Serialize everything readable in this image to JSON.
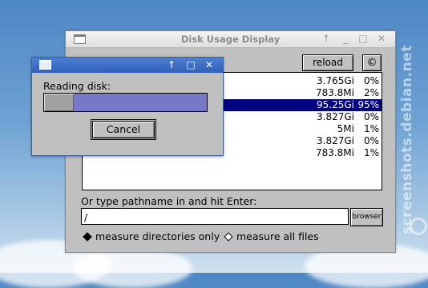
{
  "watermark": {
    "text": "screenshots.debian.net"
  },
  "main_window": {
    "title": "Disk Usage Display",
    "reload_label": "reload",
    "copyright_label": "©",
    "entries": [
      {
        "size": "3.765Gi",
        "pct": "0%",
        "selected": false
      },
      {
        "size": "783.8Mi",
        "pct": "2%",
        "selected": false
      },
      {
        "size": "95.25Gi",
        "pct": "95%",
        "selected": true
      },
      {
        "size": "3.827Gi",
        "pct": "0%",
        "selected": false
      },
      {
        "size": "5Mi",
        "pct": "1%",
        "selected": false
      },
      {
        "size": "3.827Gi",
        "pct": "0%",
        "selected": false
      },
      {
        "size": "783.8Mi",
        "pct": "1%",
        "selected": false
      }
    ],
    "path_label": "Or type pathname in and hit Enter:",
    "path_value": "/",
    "browser_label": "browser",
    "radio_dirs_label": "measure directories only",
    "radio_all_label": "measure all files",
    "selected_radio": "dirs"
  },
  "dialog": {
    "label": "Reading disk:",
    "progress": 0.18,
    "cancel_label": "Cancel"
  },
  "colors": {
    "selection": "#000080",
    "progress_track": "#7878c8",
    "dialog_titlebar": "#2f5fb8"
  }
}
